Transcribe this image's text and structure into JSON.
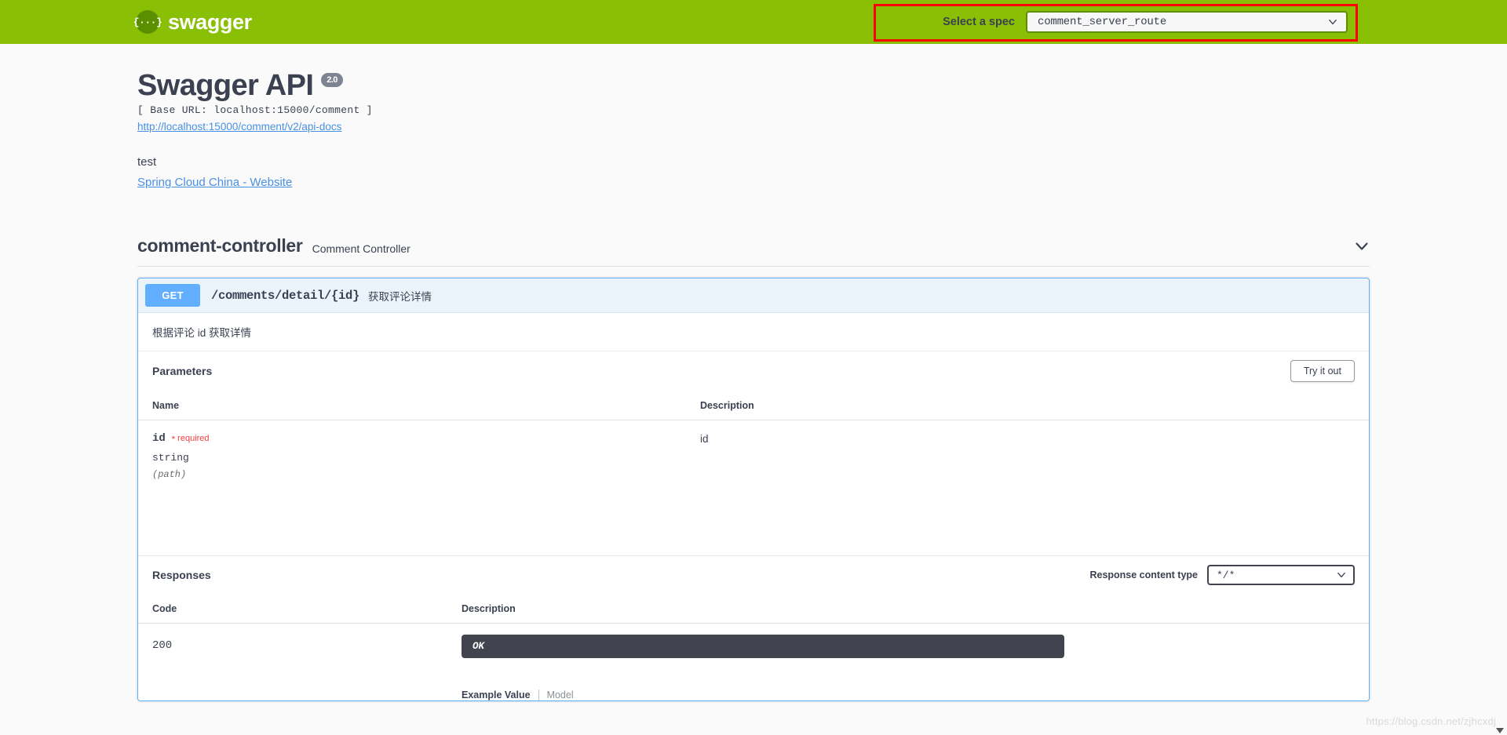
{
  "topbar": {
    "logo_glyph": "{···}",
    "logo_text": "swagger",
    "spec_label": "Select a spec",
    "spec_value": "comment_server_route",
    "spec_options": [
      "comment_server_route"
    ]
  },
  "info": {
    "title": "Swagger API",
    "version_badge": "2.0",
    "base_url": "[ Base URL: localhost:15000/comment ]",
    "docs_link": "http://localhost:15000/comment/v2/api-docs",
    "description": "test",
    "external_link": "Spring Cloud China - Website"
  },
  "tag": {
    "name": "comment-controller",
    "description": "Comment Controller"
  },
  "operation": {
    "method": "GET",
    "path": "/comments/detail/{id}",
    "summary": "获取评论详情",
    "description": "根据评论 id 获取详情",
    "parameters_title": "Parameters",
    "try_it_out_label": "Try it out",
    "param_columns": [
      "Name",
      "Description"
    ],
    "parameters": [
      {
        "name": "id",
        "required_marker": "*",
        "required_label": "required",
        "type": "string",
        "in": "(path)",
        "description": "id"
      }
    ],
    "responses_title": "Responses",
    "content_type_label": "Response content type",
    "content_type_value": "*/*",
    "content_type_options": [
      "*/*"
    ],
    "response_columns": [
      "Code",
      "Description"
    ],
    "responses": [
      {
        "code": "200",
        "description": "OK"
      }
    ],
    "example_tab_active": "Example Value",
    "example_tab_other": "Model"
  },
  "watermark": "https://blog.csdn.net/zjhcxdj",
  "colors": {
    "brand_green": "#89bf04",
    "logo_dark_green": "#5b8f00",
    "get_blue": "#61affe",
    "annotation_red": "#ff0000",
    "required_red": "#f93e3e",
    "link_blue": "#4990e2",
    "code_block_dark": "#41444e"
  }
}
